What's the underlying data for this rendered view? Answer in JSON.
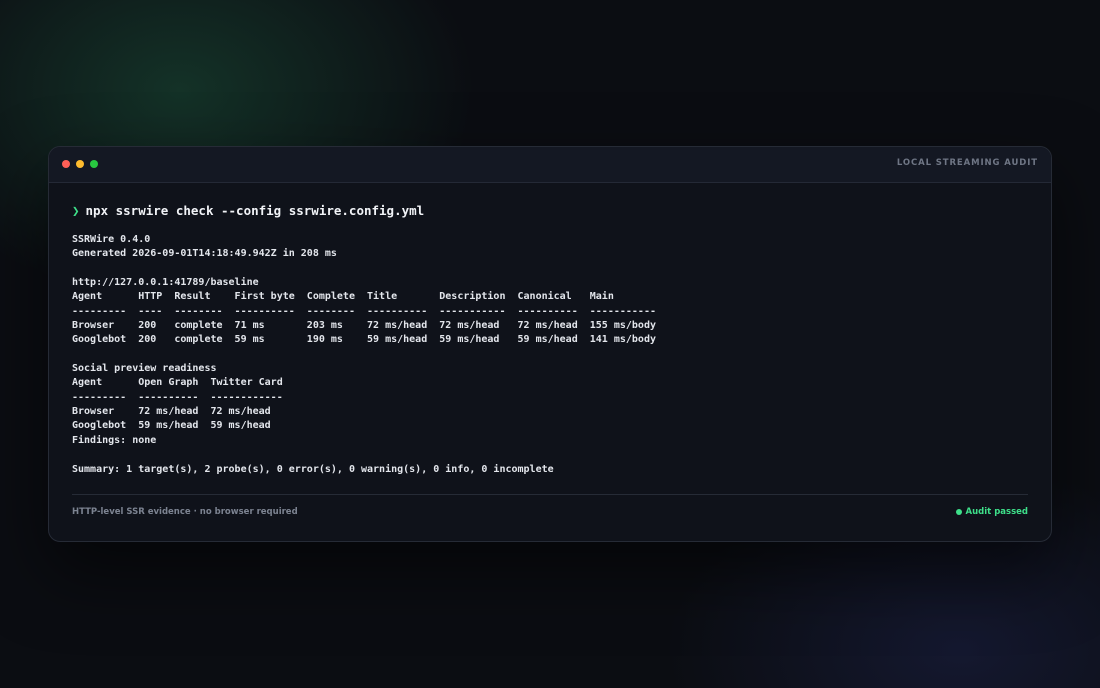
{
  "window": {
    "title": "LOCAL STREAMING AUDIT"
  },
  "terminal": {
    "prompt_symbol": "❯",
    "command": "npx ssrwire check --config ssrwire.config.yml",
    "output_lines": [
      "SSRWire 0.4.0",
      "Generated 2026-09-01T14:18:49.942Z in 208 ms",
      "",
      "http://127.0.0.1:41789/baseline",
      "Agent      HTTP  Result    First byte  Complete  Title       Description  Canonical   Main",
      "---------  ----  --------  ----------  --------  ----------  -----------  ----------  -----------",
      "Browser    200   complete  71 ms       203 ms    72 ms/head  72 ms/head   72 ms/head  155 ms/body",
      "Googlebot  200   complete  59 ms       190 ms    59 ms/head  59 ms/head   59 ms/head  141 ms/body",
      "",
      "Social preview readiness",
      "Agent      Open Graph  Twitter Card",
      "---------  ----------  ------------",
      "Browser    72 ms/head  72 ms/head",
      "Googlebot  59 ms/head  59 ms/head",
      "Findings: none",
      "",
      "Summary: 1 target(s), 2 probe(s), 0 error(s), 0 warning(s), 0 info, 0 incomplete"
    ]
  },
  "footer": {
    "note": "HTTP-level SSR evidence · no browser required",
    "status": "Audit passed"
  },
  "colors": {
    "accent_green": "#3ee08a",
    "window_bg": "#0f121a",
    "traffic_red": "#ff5f57",
    "traffic_yellow": "#febc2e",
    "traffic_green": "#28c840"
  }
}
